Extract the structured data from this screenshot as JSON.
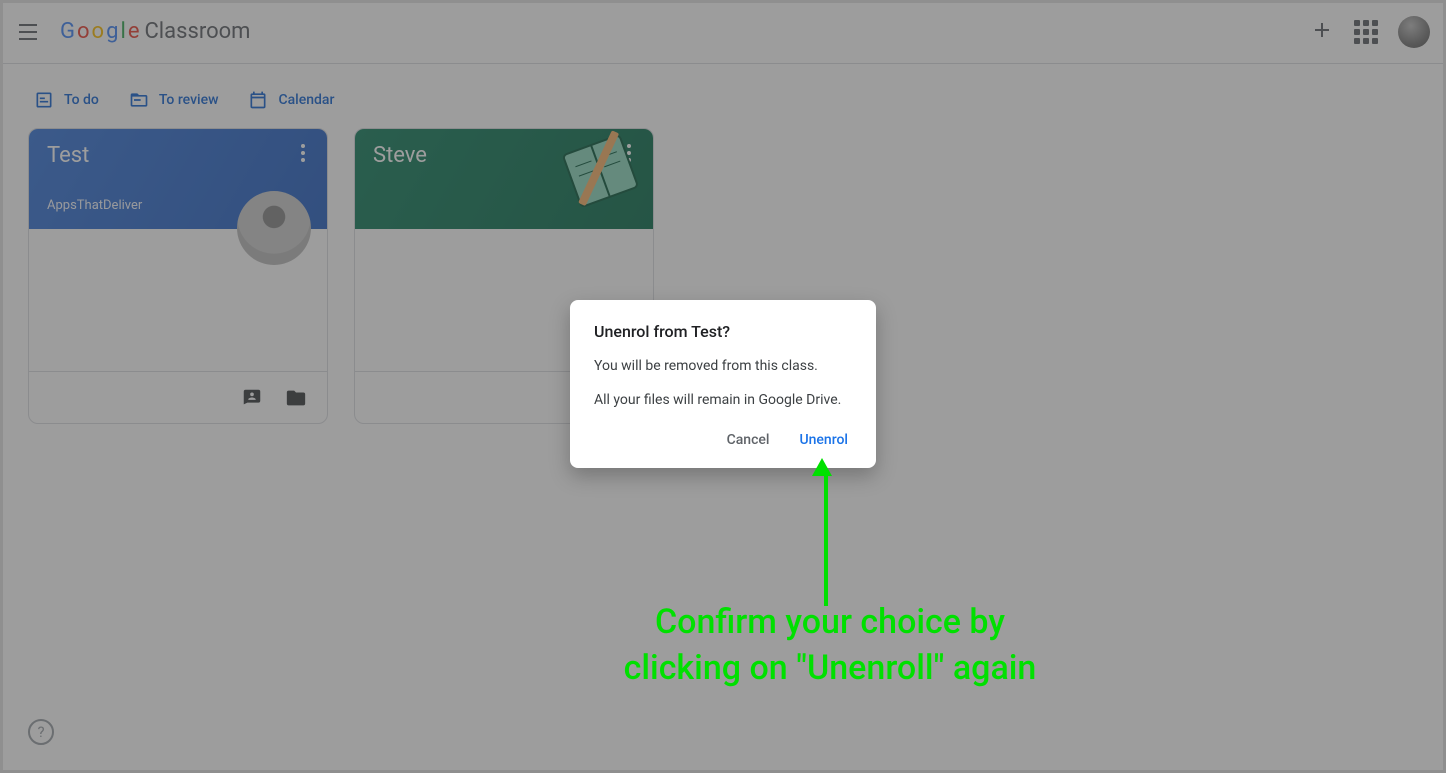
{
  "header": {
    "app_name": "Classroom"
  },
  "filters": {
    "todo": "To do",
    "review": "To review",
    "calendar": "Calendar"
  },
  "cards": [
    {
      "title": "Test",
      "subtitle": "AppsThatDeliver"
    },
    {
      "title": "Steve",
      "subtitle": ""
    }
  ],
  "dialog": {
    "title": "Unenrol from Test?",
    "line1": "You will be removed from this class.",
    "line2": "All your files will remain in Google Drive.",
    "cancel": "Cancel",
    "confirm": "Unenrol"
  },
  "annotation": {
    "text_l1": "Confirm your choice by",
    "text_l2": "clicking on \"Unenroll\" again"
  }
}
